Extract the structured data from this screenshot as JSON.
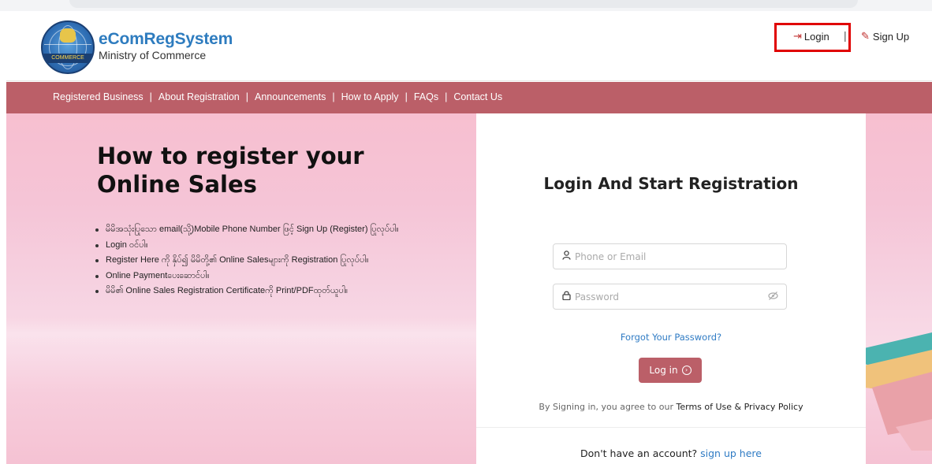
{
  "header": {
    "brand_title": "eComRegSystem",
    "brand_subtitle": "Ministry of Commerce",
    "logo_text": "COMMERCE",
    "login_label": "Login",
    "separator": "|",
    "signup_label": "Sign Up",
    "highlight_color": "#e00000"
  },
  "menu": {
    "items": [
      "Registered Business",
      "About Registration",
      "Announcements",
      "How to Apply",
      "FAQs",
      "Contact Us"
    ],
    "separator": "|",
    "color": "#bb5f68"
  },
  "hero": {
    "title": "How to register your Online Sales",
    "steps": [
      "မိမိအသုံးပြုသော email(သို့)Mobile Phone Number ဖြင့် Sign Up (Register) ပြုလုပ်ပါ။",
      "Login ဝင်ပါ။",
      "Register Here ကို နှိပ်၍ မိမိတို့၏ Online Salesများကို Registration ပြုလုပ်ပါ။",
      "Online Paymentပေးဆောင်ပါ။",
      "မိမိ၏ Online Sales Registration Certificateကို Print/PDFထုတ်ယူပါ။"
    ]
  },
  "login_card": {
    "title": "Login And Start Registration",
    "email_placeholder": "Phone or Email",
    "password_placeholder": "Password",
    "forgot_label": "Forgot Your Password?",
    "login_button": "Log in",
    "agree_prefix": "By Signing in, you agree to our ",
    "agree_terms": "Terms of Use & Privacy Policy",
    "no_account_prefix": "Don't have an account? ",
    "signup_link": "sign up here"
  },
  "icons": {
    "login": "sign-in-icon",
    "signup": "edit-icon",
    "user": "user-icon",
    "lock": "lock-icon",
    "eye": "eye-off-icon",
    "arrow": "arrow-circle-right-icon"
  }
}
